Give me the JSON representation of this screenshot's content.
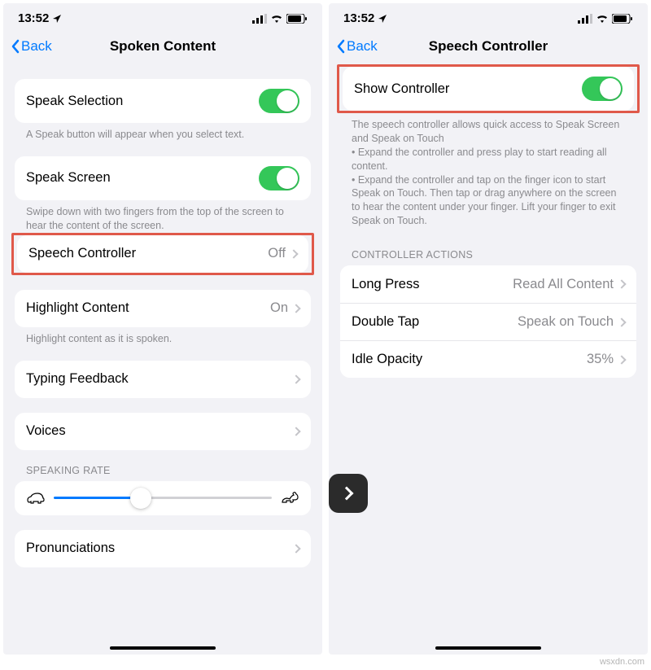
{
  "status": {
    "time": "13:52"
  },
  "left": {
    "back": "Back",
    "title": "Spoken Content",
    "speak_selection": {
      "label": "Speak Selection",
      "footer": "A Speak button will appear when you select text."
    },
    "speak_screen": {
      "label": "Speak Screen",
      "footer": "Swipe down with two fingers from the top of the screen to hear the content of the screen."
    },
    "speech_controller": {
      "label": "Speech Controller",
      "value": "Off"
    },
    "highlight": {
      "label": "Highlight Content",
      "value": "On",
      "footer": "Highlight content as it is spoken."
    },
    "typing_feedback": {
      "label": "Typing Feedback"
    },
    "voices": {
      "label": "Voices"
    },
    "rate_header": "SPEAKING RATE",
    "pronunciations": {
      "label": "Pronunciations"
    }
  },
  "right": {
    "back": "Back",
    "title": "Speech Controller",
    "show_controller": {
      "label": "Show Controller"
    },
    "description": "The speech controller allows quick access to Speak Screen and Speak on Touch\n • Expand the controller and press play to start reading all content.\n • Expand the controller and tap on the finger icon to start Speak on Touch. Then tap or drag anywhere on the screen to hear the content under your finger. Lift your finger to exit Speak on Touch.",
    "actions_header": "CONTROLLER ACTIONS",
    "long_press": {
      "label": "Long Press",
      "value": "Read All Content"
    },
    "double_tap": {
      "label": "Double Tap",
      "value": "Speak on Touch"
    },
    "idle_opacity": {
      "label": "Idle Opacity",
      "value": "35%"
    }
  },
  "watermark": "wsxdn.com"
}
